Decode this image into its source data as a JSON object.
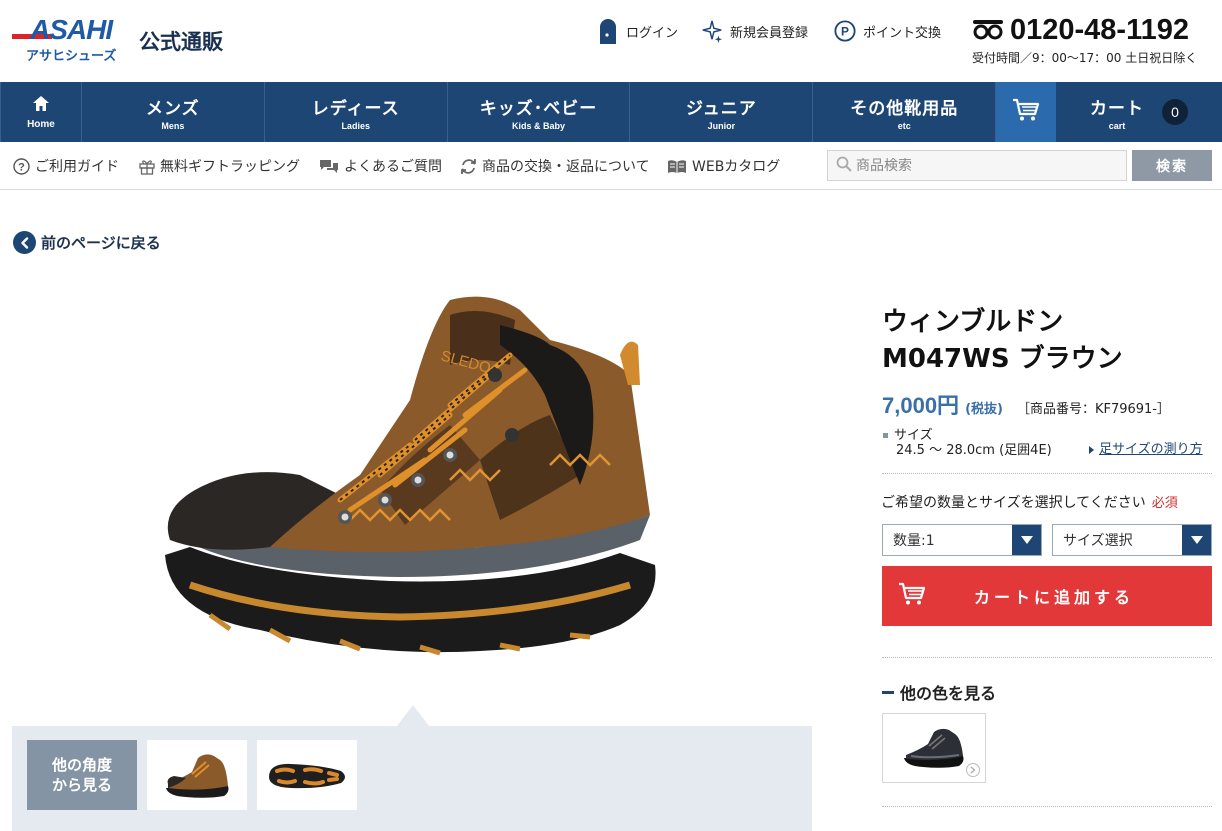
{
  "brand": {
    "logo_text": "ASAHI",
    "logo_sub": "アサヒシューズ",
    "tagline": "公式通販"
  },
  "header": {
    "login_label": "ログイン",
    "register_label": "新規会員登録",
    "points_label": "ポイント交換",
    "phone_number": "0120-48-1192",
    "hours": "受付時間／9：00～17：00 土日祝日除く"
  },
  "nav": {
    "home": {
      "ja": "",
      "en": "Home"
    },
    "categories": [
      {
        "ja": "メンズ",
        "en": "Mens"
      },
      {
        "ja": "レディース",
        "en": "Ladies"
      },
      {
        "ja": "キッズ･ベビー",
        "en": "Kids & Baby"
      },
      {
        "ja": "ジュニア",
        "en": "Junior"
      },
      {
        "ja": "その他靴用品",
        "en": "etc"
      }
    ],
    "cart": {
      "ja": "カート",
      "en": "cart",
      "count": "0"
    }
  },
  "utility": {
    "links": [
      {
        "label": "ご利用ガイド",
        "icon": "help-circle-icon"
      },
      {
        "label": "無料ギフトラッピング",
        "icon": "gift-icon"
      },
      {
        "label": "よくあるご質問",
        "icon": "chat-bubbles-icon"
      },
      {
        "label": "商品の交換・返品について",
        "icon": "exchange-arrows-icon"
      },
      {
        "label": "WEBカタログ",
        "icon": "book-icon"
      }
    ],
    "search_placeholder": "商品検索",
    "search_button": "検索"
  },
  "back_label": "前のページに戻る",
  "gallery": {
    "angle_label_line1": "他の角度",
    "angle_label_line2": "から見る"
  },
  "product": {
    "name_line1": "ウィンブルドン",
    "name_line2": "M047WS ブラウン",
    "price": "7,000円",
    "tax_note": "(税抜)",
    "code": "［商品番号：KF79691-］",
    "size_label": "サイズ",
    "size_range": "24.5 ～ 28.0cm (足囲4E)",
    "size_guide_link": "足サイズの測り方",
    "select_hint": "ご希望の数量とサイズを選択してください",
    "required": "必須",
    "quantity_select": "数量:1",
    "size_select": "サイズ選択",
    "add_to_cart": "カートに追加する",
    "other_colors_title": "他の色を見る"
  },
  "colors": {
    "brand_blue": "#1e4675",
    "cart_red": "#e2383a",
    "price_blue": "#3a6fa8"
  }
}
